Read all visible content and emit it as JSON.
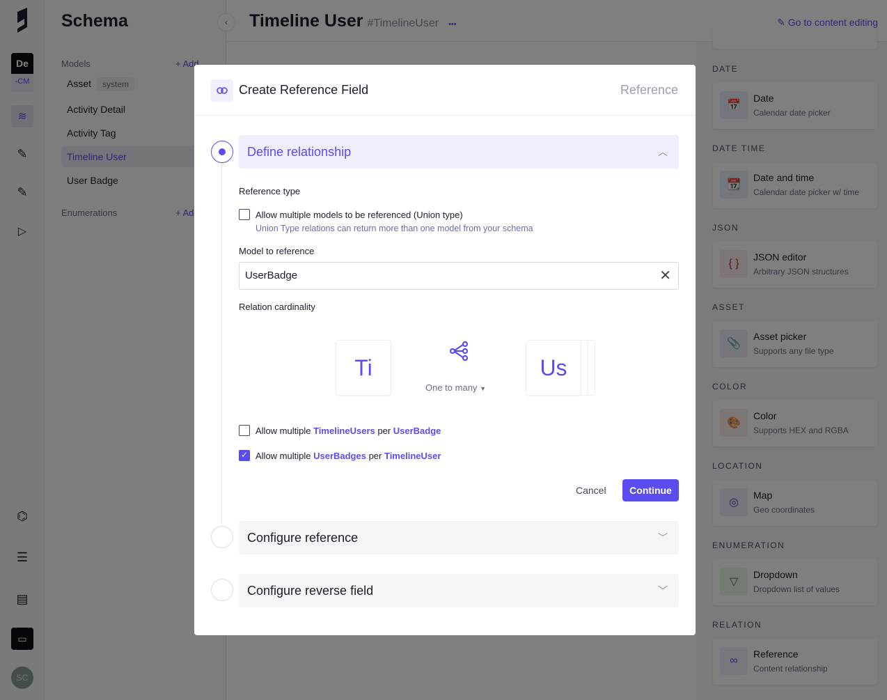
{
  "rail": {
    "project_initials": "De",
    "project_sub": "-CM",
    "avatar": "SC",
    "icons": [
      "logo-icon",
      "layers-icon",
      "edit-icon",
      "edit-asset-icon",
      "play-icon",
      "webhook-icon",
      "settings-sliders-icon",
      "docs-icon",
      "chat-icon"
    ]
  },
  "schema": {
    "title": "Schema",
    "models_label": "Models",
    "add_label": "+ Add",
    "models": [
      {
        "name": "Asset",
        "tag": "system"
      },
      {
        "name": "Activity Detail"
      },
      {
        "name": "Activity Tag"
      },
      {
        "name": "Timeline User",
        "active": true
      },
      {
        "name": "User Badge"
      }
    ],
    "enumerations_label": "Enumerations",
    "enum_add": "+ Add"
  },
  "header": {
    "title": "Timeline User",
    "hash": "#TimelineUser",
    "more": "•••",
    "goto": "Go to content editing"
  },
  "right": {
    "sections": [
      {
        "label": "DATE",
        "name": "Date",
        "desc": "Calendar date picker",
        "icon": "calendar-icon",
        "color": "#3a5a8a",
        "bg": "#e6eef6",
        "glyph": "📅"
      },
      {
        "label": "DATE TIME",
        "name": "Date and time",
        "desc": "Calendar date picker w/ time",
        "icon": "calendar-time-icon",
        "color": "#3a5a8a",
        "bg": "#e6eef6",
        "glyph": "📆"
      },
      {
        "label": "JSON",
        "name": "JSON editor",
        "desc": "Arbitrary JSON structures",
        "icon": "braces-icon",
        "color": "#b03030",
        "bg": "#f9ecec",
        "glyph": "{ }"
      },
      {
        "label": "ASSET",
        "name": "Asset picker",
        "desc": "Supports any file type",
        "icon": "paperclip-icon",
        "color": "#5b3cc0",
        "bg": "#efecf9",
        "glyph": "📎"
      },
      {
        "label": "COLOR",
        "name": "Color",
        "desc": "Supports HEX and RGBA",
        "icon": "palette-icon",
        "color": "#a05a20",
        "bg": "#f8efe8",
        "glyph": "🎨"
      },
      {
        "label": "LOCATION",
        "name": "Map",
        "desc": "Geo coordinates",
        "icon": "map-pin-icon",
        "color": "#3a4ab0",
        "bg": "#ebeefa",
        "glyph": "◎"
      },
      {
        "label": "ENUMERATION",
        "name": "Dropdown",
        "desc": "Dropdown list of values",
        "icon": "dropdown-icon",
        "color": "#3a7a3a",
        "bg": "#ebf5eb",
        "glyph": "▽"
      },
      {
        "label": "RELATION",
        "name": "Reference",
        "desc": "Content relationship",
        "icon": "link-icon",
        "color": "#5b4cf0",
        "bg": "#efeefd",
        "glyph": "∞"
      }
    ]
  },
  "modal": {
    "title": "Create Reference Field",
    "type": "Reference",
    "steps": [
      {
        "title": "Define relationship"
      },
      {
        "title": "Configure reference"
      },
      {
        "title": "Configure reverse field"
      }
    ],
    "reference_type_label": "Reference type",
    "union_label": "Allow multiple models to be referenced (Union type)",
    "union_hint": "Union Type relations can return more than one model from your schema",
    "union_checked": false,
    "model_label": "Model to reference",
    "model_value": "UserBadge",
    "cardinality_label": "Relation cardinality",
    "from_abbr": "Ti",
    "to_abbr": "Us",
    "cardinality": "One to many",
    "opt1": {
      "pre": "Allow multiple ",
      "a": "TimelineUsers",
      "mid": " per ",
      "b": "UserBadge",
      "checked": false
    },
    "opt2": {
      "pre": "Allow multiple ",
      "a": "UserBadges",
      "mid": " per ",
      "b": "TimelineUser",
      "checked": true
    },
    "cancel": "Cancel",
    "continue": "Continue",
    "accent": "#5b4cf0"
  }
}
